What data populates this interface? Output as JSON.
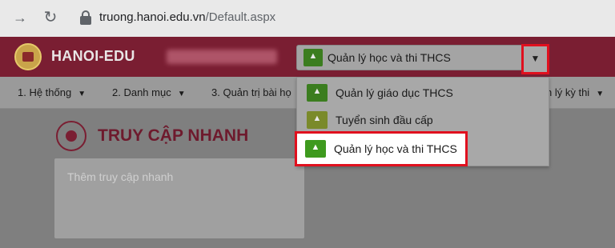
{
  "browser": {
    "back_icon": "arrow-right-icon",
    "reload_icon": "reload-icon",
    "url_domain": "truong.hanoi.edu.vn",
    "url_path": "/Default.aspx"
  },
  "header": {
    "brand": "HANOI-EDU",
    "selected_module": "Quản lý học và thi THCS",
    "colors": {
      "bar": "#7a1e32",
      "highlight": "#e0101e"
    }
  },
  "menu": {
    "items": [
      {
        "label": "1. Hệ thống"
      },
      {
        "label": "2. Danh mục"
      },
      {
        "label": "3. Quản trị bài họ"
      },
      {
        "label": "n lý kỳ thi"
      }
    ]
  },
  "dropdown": {
    "options": [
      {
        "label": "Quản lý giáo dục THCS",
        "color": "#3b7d1f"
      },
      {
        "label": "Tuyển sinh đầu cấp",
        "color": "#7a8a2a"
      },
      {
        "label": "Quản lý học và thi THCS",
        "color": "#3e9a1e"
      }
    ]
  },
  "quick_access": {
    "title": "TRUY CẬP NHANH",
    "placeholder": "Thêm truy cập nhanh"
  }
}
